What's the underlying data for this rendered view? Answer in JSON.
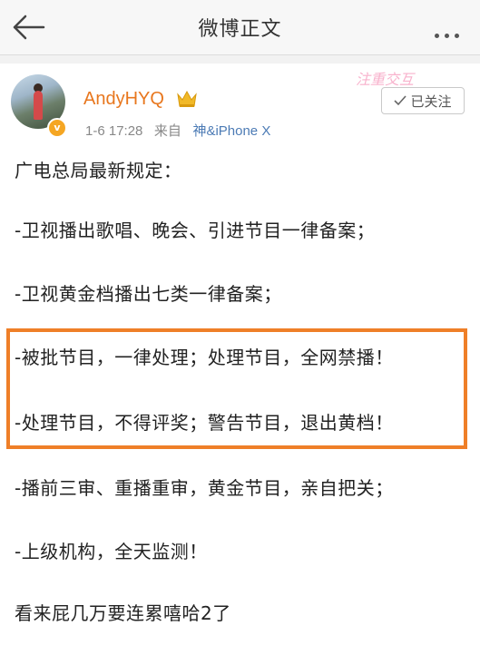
{
  "header": {
    "title": "微博正文"
  },
  "post": {
    "author": "AndyHYQ",
    "timestamp": "1-6 17:28",
    "source_prefix": "来自",
    "source": "神&iPhone X",
    "follow_label": "已关注",
    "watermark": "注重交互",
    "lines": [
      "广电总局最新规定：",
      "-卫视播出歌唱、晚会、引进节目一律备案；",
      "-卫视黄金档播出七类一律备案；",
      "-被批节目，一律处理；处理节目，全网禁播！",
      "-处理节目，不得评奖；警告节目，退出黄档！",
      "-播前三审、重播重审，黄金节目，亲自把关；",
      "-上级机构，全天监测！",
      "看来屁几万要连累嘻哈2了"
    ]
  },
  "colors": {
    "accent_orange": "#ef7f28",
    "username_orange": "#e8771e",
    "link_blue": "#4c7bb5",
    "badge_yellow": "#f5a623"
  }
}
